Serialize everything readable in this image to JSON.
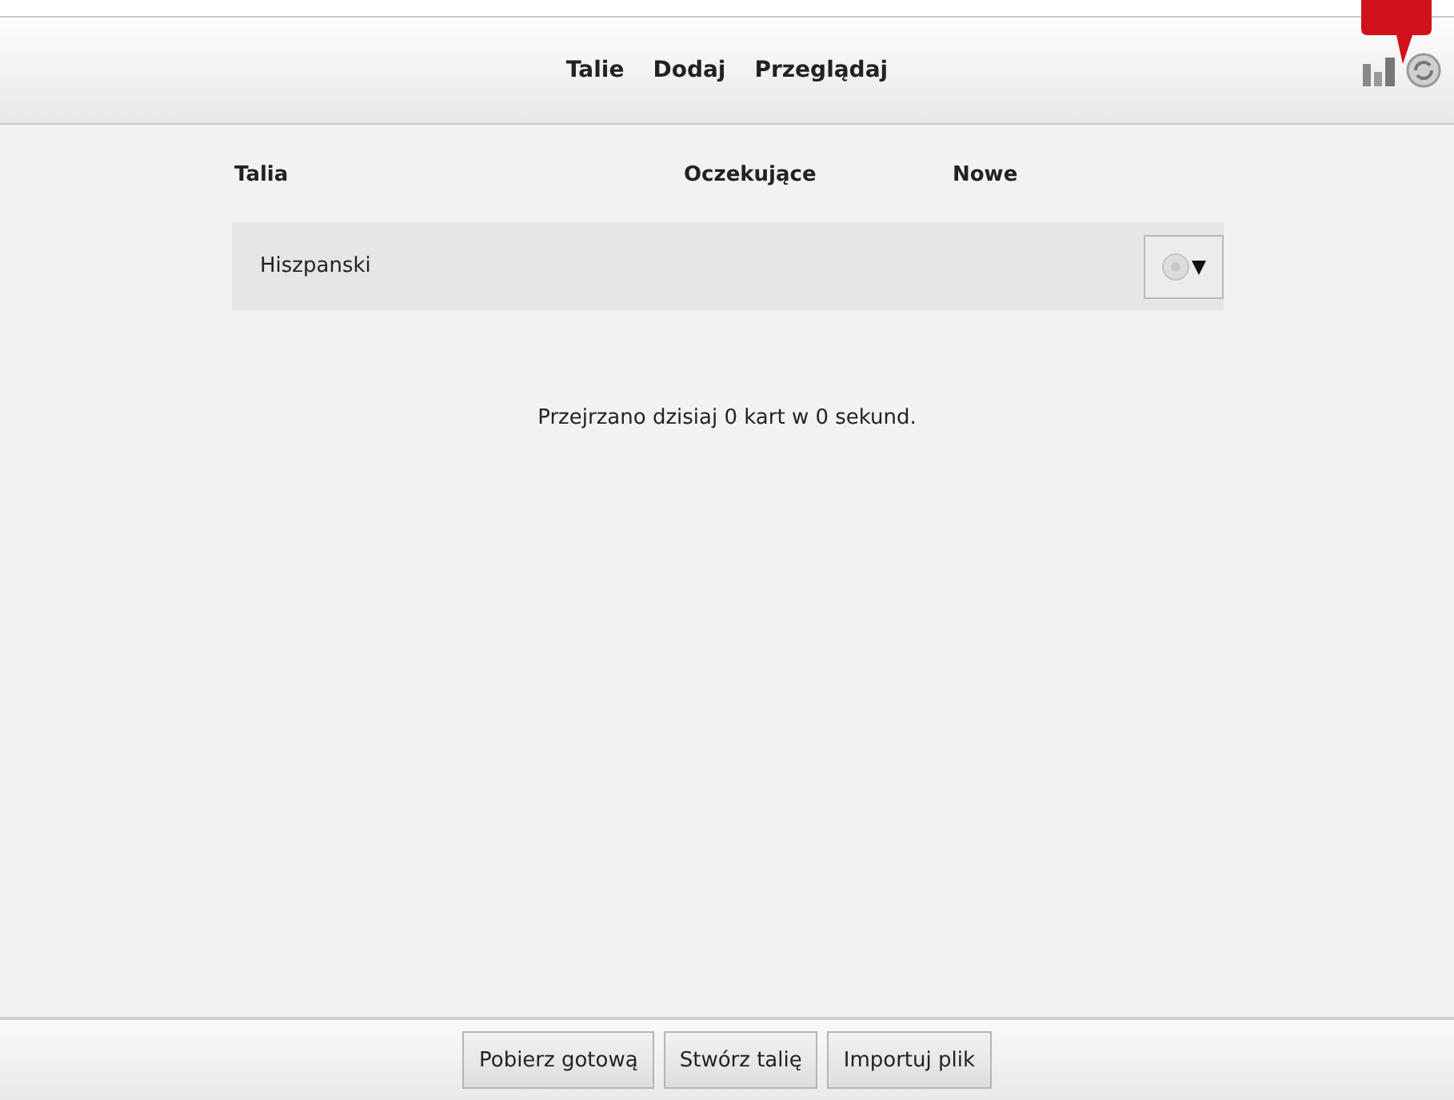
{
  "toolbar": {
    "nav": [
      "Talie",
      "Dodaj",
      "Przeglądaj"
    ]
  },
  "table": {
    "columns": [
      "Talia",
      "Oczekujące",
      "Nowe"
    ],
    "rows": [
      {
        "name": "Hiszpanski"
      }
    ]
  },
  "summary": "Przejrzano dzisiaj 0 kart w 0 sekund.",
  "buttons": [
    "Pobierz gotową",
    "Stwórz talię",
    "Importuj plik"
  ]
}
